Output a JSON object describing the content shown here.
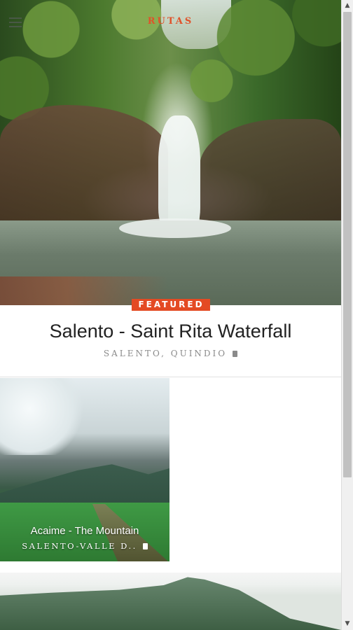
{
  "header": {
    "app_title": "RUTAS",
    "menu_icon": "hamburger-menu-icon"
  },
  "featured": {
    "badge": "FEATURED",
    "title": "Salento - Saint Rita Waterfall",
    "location": "SALENTO, QUINDIO",
    "location_icon": "map-pin-icon",
    "image": "waterfall-photo"
  },
  "routes": [
    {
      "title": "Acaime - The Mountain",
      "location": "SALENTO-VALLE D..",
      "location_icon": "map-pin-icon",
      "image": "mountain-valley-photo"
    }
  ],
  "next_card": {
    "image": "hills-photo"
  },
  "colors": {
    "accent": "#e44a23",
    "logo": "#e0522a",
    "title_text": "#222222",
    "meta_text": "#8a8a8a"
  },
  "scrollbar": {
    "up_icon": "scroll-up-arrow-icon",
    "down_icon": "scroll-down-arrow-icon"
  }
}
